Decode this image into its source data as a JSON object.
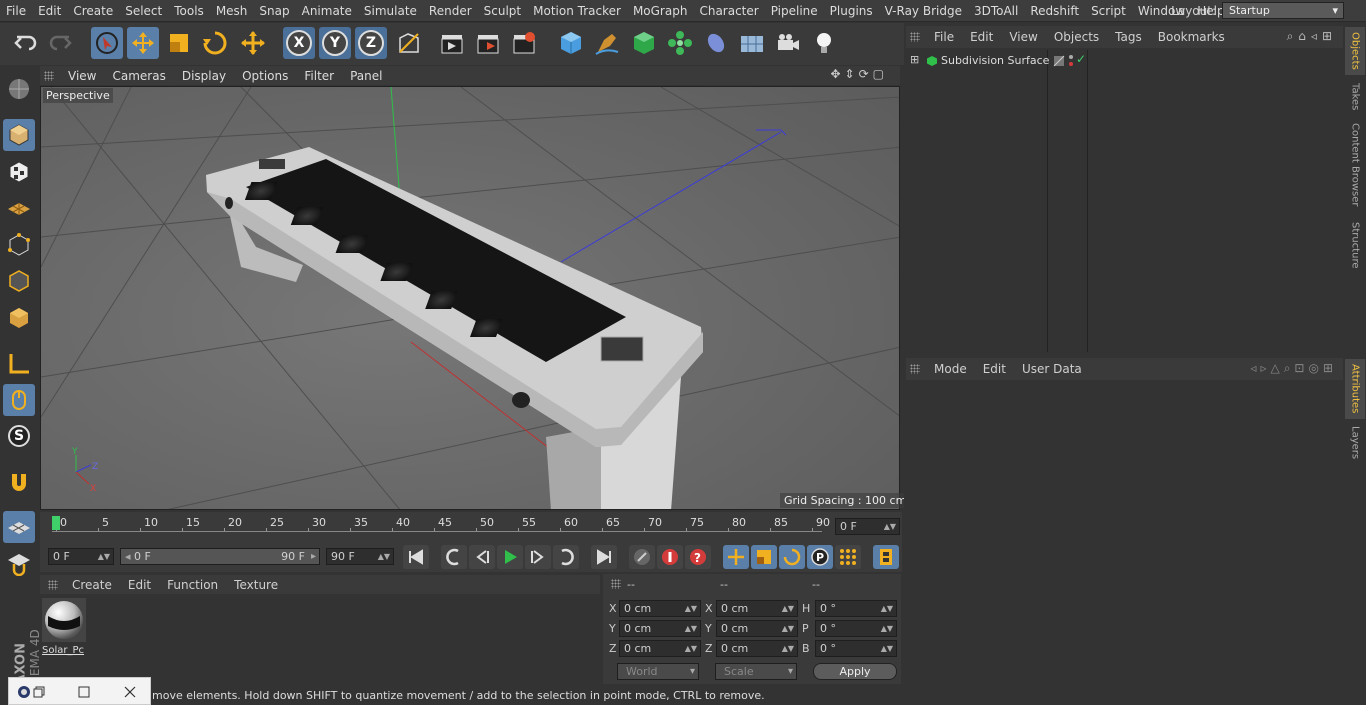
{
  "menubar": {
    "items": [
      "File",
      "Edit",
      "Create",
      "Select",
      "Tools",
      "Mesh",
      "Snap",
      "Animate",
      "Simulate",
      "Render",
      "Sculpt",
      "Motion Tracker",
      "MoGraph",
      "Character",
      "Pipeline",
      "Plugins",
      "V-Ray Bridge",
      "3DToAll",
      "Redshift",
      "Script",
      "Window",
      "Help"
    ],
    "layout_label": "Layout:",
    "layout_value": "Startup"
  },
  "toolbar": {
    "axis_x": "X",
    "axis_y": "Y",
    "axis_z": "Z"
  },
  "left_tools": {
    "s_label": "S"
  },
  "viewport_menu": {
    "items": [
      "View",
      "Cameras",
      "Display",
      "Options",
      "Filter",
      "Panel"
    ]
  },
  "viewport": {
    "name": "Perspective",
    "grid_spacing": "Grid Spacing : 100 cm",
    "axis_y": "Y",
    "axis_z": "Z",
    "axis_x": "X"
  },
  "timeline": {
    "ticks": [
      "0",
      "5",
      "10",
      "15",
      "20",
      "25",
      "30",
      "35",
      "40",
      "45",
      "50",
      "55",
      "60",
      "65",
      "70",
      "75",
      "80",
      "85",
      "90"
    ],
    "current_frame": "0 F"
  },
  "transport": {
    "start_frame": "0 F",
    "range_start": "0 F",
    "range_end": "90 F",
    "end_frame": "90 F",
    "p_label": "P"
  },
  "materials": {
    "menu": [
      "Create",
      "Edit",
      "Function",
      "Texture"
    ],
    "items": [
      {
        "name": "Solar_Pc"
      }
    ]
  },
  "coordinates": {
    "headers": [
      "--",
      "--",
      "--"
    ],
    "rows": [
      {
        "a": "X",
        "a_val": "0 cm",
        "b": "X",
        "b_val": "0 cm",
        "c": "H",
        "c_val": "0 °"
      },
      {
        "a": "Y",
        "a_val": "0 cm",
        "b": "Y",
        "b_val": "0 cm",
        "c": "P",
        "c_val": "0 °"
      },
      {
        "a": "Z",
        "a_val": "0 cm",
        "b": "Z",
        "b_val": "0 cm",
        "c": "B",
        "c_val": "0 °"
      }
    ],
    "space": "World",
    "mode": "Scale",
    "apply": "Apply"
  },
  "status": {
    "text": "move elements. Hold down SHIFT to quantize movement / add to the selection in point mode, CTRL to remove."
  },
  "object_manager": {
    "menu": [
      "File",
      "Edit",
      "View",
      "Objects",
      "Tags",
      "Bookmarks"
    ],
    "objects": [
      {
        "name": "Subdivision Surface",
        "expand": "⊞"
      }
    ]
  },
  "attribute_manager": {
    "menu": [
      "Mode",
      "Edit",
      "User Data"
    ]
  },
  "side_tabs": {
    "top": [
      "Objects",
      "Takes",
      "Content Browser",
      "Structure"
    ],
    "bottom": [
      "Attributes",
      "Layers"
    ]
  },
  "branding": {
    "maxon": "MAXON",
    "product": "CINEMA 4D"
  },
  "colors": {
    "accent": "#5a7fa8",
    "play": "#2fbf4a",
    "record": "#d43c3c"
  }
}
